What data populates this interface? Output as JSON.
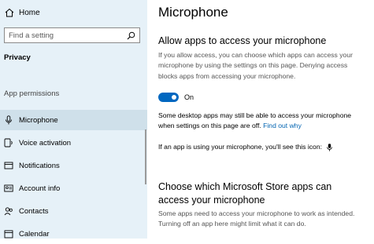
{
  "sidebar": {
    "home_label": "Home",
    "search_placeholder": "Find a setting",
    "section_label": "Privacy",
    "group_label": "App permissions",
    "items": [
      {
        "label": "Microphone",
        "icon": "microphone-icon",
        "active": true
      },
      {
        "label": "Voice activation",
        "icon": "voice-activation-icon",
        "active": false
      },
      {
        "label": "Notifications",
        "icon": "notifications-icon",
        "active": false
      },
      {
        "label": "Account info",
        "icon": "account-info-icon",
        "active": false
      },
      {
        "label": "Contacts",
        "icon": "contacts-icon",
        "active": false
      },
      {
        "label": "Calendar",
        "icon": "calendar-icon",
        "active": false
      }
    ]
  },
  "main": {
    "title": "Microphone",
    "allow_heading": "Allow apps to access your microphone",
    "allow_description": "If you allow access, you can choose which apps can access your microphone by using the settings on this page. Denying access blocks apps from accessing your microphone.",
    "toggle_state": "On",
    "desktop_note": "Some desktop apps may still be able to access your microphone when settings on this page are off.",
    "find_out_why": "Find out why",
    "icon_note": "If an app is using your microphone, you'll see this icon:",
    "store_heading": "Choose which Microsoft Store apps can access your microphone",
    "store_description": "Some apps need to access your microphone to work as intended. Turning off an app here might limit what it can do."
  },
  "colors": {
    "sidebar_bg": "#e6f1f8",
    "accent": "#0067c0",
    "link": "#0063b1"
  }
}
